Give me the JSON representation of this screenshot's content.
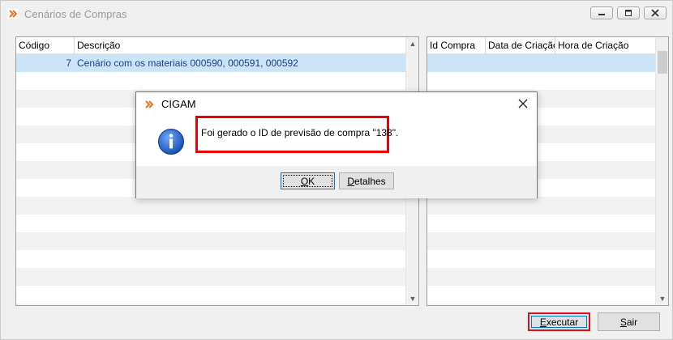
{
  "window": {
    "title": "Cenários de Compras"
  },
  "left_grid": {
    "columns": [
      "Código",
      "Descrição"
    ],
    "rows": [
      {
        "codigo": "7",
        "descricao": "Cenário com os materiais 000590, 000591, 000592"
      }
    ]
  },
  "right_grid": {
    "columns": [
      "Id Compra",
      "Data de Criação",
      "Hora de Criação"
    ]
  },
  "buttons": {
    "executar": "Executar",
    "sair": "Sair"
  },
  "dialog": {
    "title": "CIGAM",
    "message": "Foi gerado o ID de previsão de compra \"138\".",
    "ok": "OK",
    "detalhes": "Detalhes"
  },
  "colors": {
    "selection": "#cce4f7",
    "highlight_border": "#e00000",
    "icon_orange": "#e8741a",
    "info_blue": "#1f5fbf"
  }
}
